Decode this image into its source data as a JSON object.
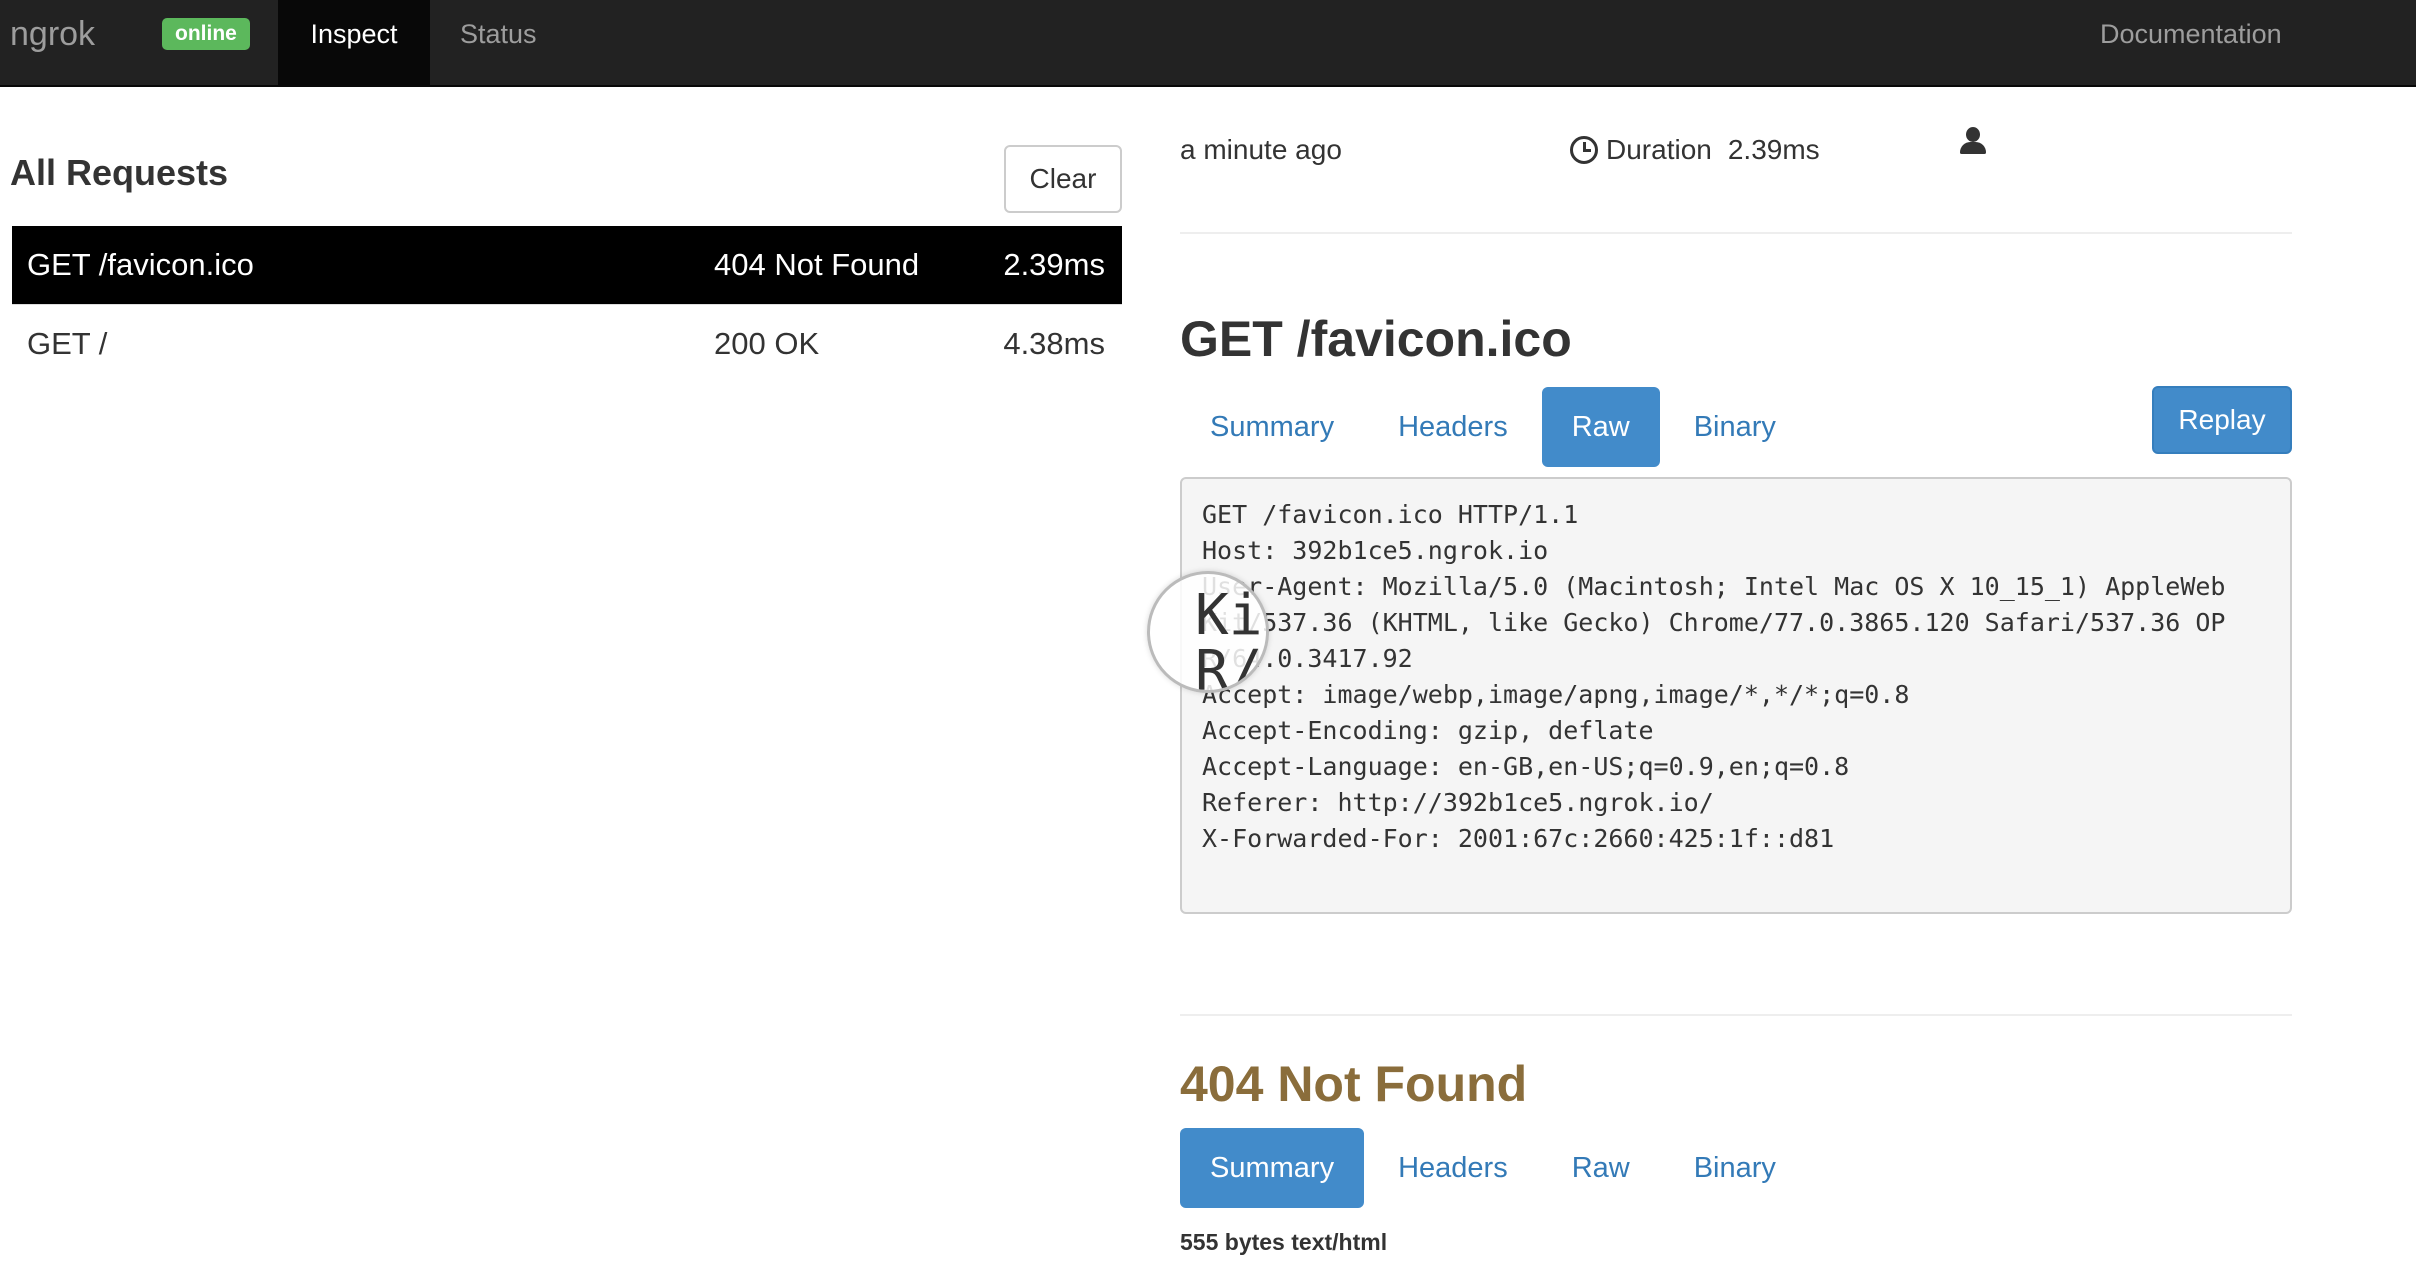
{
  "navbar": {
    "brand": "ngrok",
    "status_badge": "online",
    "tabs": [
      {
        "label": "Inspect",
        "active": true
      },
      {
        "label": "Status",
        "active": false
      }
    ],
    "docs_link": "Documentation"
  },
  "requests_panel": {
    "title": "All Requests",
    "clear_label": "Clear",
    "rows": [
      {
        "path": "GET /favicon.ico",
        "status": "404 Not Found",
        "duration": "2.39ms",
        "selected": true
      },
      {
        "path": "GET /",
        "status": "200 OK",
        "duration": "4.38ms",
        "selected": false
      }
    ]
  },
  "detail": {
    "time_ago": "a minute ago",
    "duration_label": "Duration",
    "duration_value": "2.39ms",
    "request": {
      "title": "GET /favicon.ico",
      "tabs": [
        "Summary",
        "Headers",
        "Raw",
        "Binary"
      ],
      "active_tab": "Raw",
      "replay_label": "Replay",
      "raw_lines": [
        "GET /favicon.ico HTTP/1.1",
        "Host: 392b1ce5.ngrok.io",
        "User-Agent: Mozilla/5.0 (Macintosh; Intel Mac OS X 10_15_1) AppleWeb",
        "Kit/537.36 (KHTML, like Gecko) Chrome/77.0.3865.120 Safari/537.36 OP",
        "R/64.0.3417.92",
        "Accept: image/webp,image/apng,image/*,*/*;q=0.8",
        "Accept-Encoding: gzip, deflate",
        "Accept-Language: en-GB,en-US;q=0.9,en;q=0.8",
        "Referer: http://392b1ce5.ngrok.io/",
        "X-Forwarded-For: 2001:67c:2660:425:1f::d81"
      ],
      "magnifier_text_line1": "Ki",
      "magnifier_text_line2": "R/"
    },
    "response": {
      "title": "404 Not Found",
      "tabs": [
        "Summary",
        "Headers",
        "Raw",
        "Binary"
      ],
      "active_tab": "Summary",
      "size_text": "555 bytes text/html"
    }
  },
  "colors": {
    "navbar_bg": "#222222",
    "online_badge": "#5cb85c",
    "primary_button": "#428bca",
    "link": "#337ab7",
    "warning_title": "#8a6d3b"
  }
}
